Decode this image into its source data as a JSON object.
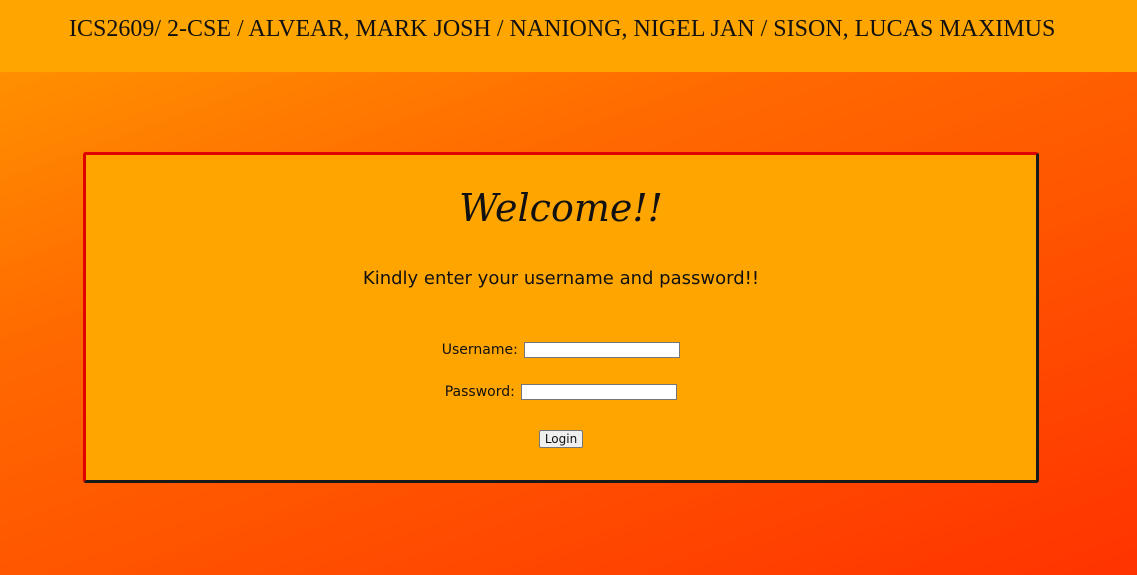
{
  "header": {
    "title": "ICS2609/ 2-CSE / ALVEAR, MARK JOSH / NANIONG, NIGEL JAN / SISON, LUCAS MAXIMUS"
  },
  "login": {
    "heading": "Welcome!!",
    "instruction": "Kindly enter your username and password!!",
    "username_label": "Username:",
    "username_value": "",
    "password_label": "Password:",
    "password_value": "",
    "button_label": "Login"
  },
  "colors": {
    "header_bg": "#ffa500",
    "card_bg": "#ffa500",
    "gradient_start": "#ff9a00",
    "gradient_end": "#ff3300",
    "card_border_top": "#e00000",
    "card_border_bottom": "#1a1a1a"
  }
}
